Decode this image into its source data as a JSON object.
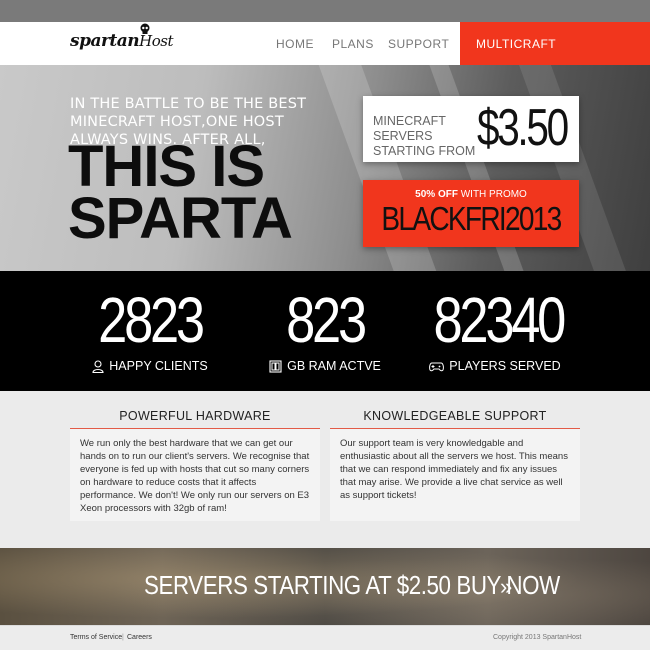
{
  "brand": {
    "logo_main": "spartan",
    "logo_sub": "Host"
  },
  "nav": {
    "items": [
      {
        "label": "HOME"
      },
      {
        "label": "PLANS"
      },
      {
        "label": "SUPPORT"
      }
    ],
    "cta": "MULTICRAFT"
  },
  "hero": {
    "tagline": "IN THE BATTLE TO BE THE BEST MINECRAFT HOST,ONE HOST ALWAYS WINS. AFTER ALL,",
    "title_line1": "THIS IS",
    "title_line2": "SPARTA",
    "price_label": "MINECRAFT SERVERS STARTING FROM",
    "price_value": "$3.50",
    "promo_discount": "50% OFF",
    "promo_suffix": " WITH PROMO",
    "promo_code": "BLACKFRI2013"
  },
  "stats": [
    {
      "value": "2823",
      "label": "HAPPY CLIENTS",
      "icon": "user-icon"
    },
    {
      "value": "823",
      "label": "GB RAM ACTVE",
      "icon": "memory-icon"
    },
    {
      "value": "82340",
      "label": "PLAYERS SERVED",
      "icon": "gamepad-icon"
    }
  ],
  "features": [
    {
      "title": "POWERFUL HARDWARE",
      "body": "We run only the best hardware that we can get our hands on to run our client's servers. We recognise that everyone is fed up with hosts that cut so many corners on hardware to reduce costs that it affects performance. We don't! We only run our servers on E3 Xeon processors with 32gb of ram!"
    },
    {
      "title": "KNOWLEDGEABLE SUPPORT",
      "body": "Our support team is very knowledgable and enthusiastic about all the servers we host. This means that we can respond immediately and fix any issues that may arise. We provide a live chat service as well as support tickets!"
    }
  ],
  "banner": {
    "text": "SERVERS STARTING AT $2.50 BUY NOW",
    "chevron": "»"
  },
  "footer": {
    "terms": "Terms of Service",
    "separator": "|",
    "careers": "Careers",
    "copyright": "Copyright 2013 SpartanHost"
  },
  "colors": {
    "accent": "#f1361d",
    "dark": "#000000",
    "light": "#ebebeb"
  }
}
